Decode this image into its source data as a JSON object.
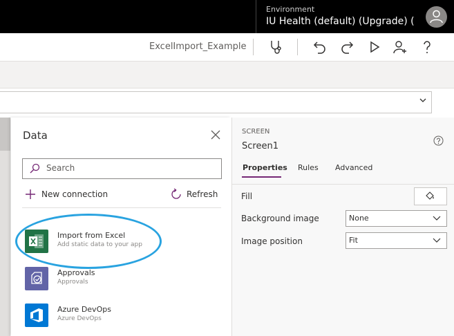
{
  "header": {
    "environment_label": "Environment",
    "environment_value": "IU Health (default) (Upgrade) (o..."
  },
  "commandbar": {
    "app_name": "ExcelImport_Example"
  },
  "data_panel": {
    "title": "Data",
    "search_placeholder": "Search",
    "new_connection_label": "New connection",
    "refresh_label": "Refresh",
    "items": [
      {
        "title": "Import from Excel",
        "subtitle": "Add static data to your app",
        "icon": "excel-icon",
        "color": "#217346"
      },
      {
        "title": "Approvals",
        "subtitle": "Approvals",
        "icon": "approvals-icon",
        "color": "#6264a7"
      },
      {
        "title": "Azure DevOps",
        "subtitle": "Azure DevOps",
        "icon": "azure-devops-icon",
        "color": "#0078d4"
      }
    ]
  },
  "properties": {
    "section_label": "SCREEN",
    "screen_name": "Screen1",
    "tabs": [
      "Properties",
      "Rules",
      "Advanced"
    ],
    "fill_label": "Fill",
    "background_image_label": "Background image",
    "background_image_value": "None",
    "image_position_label": "Image position",
    "image_position_value": "Fit"
  },
  "colors": {
    "accent": "#742774",
    "highlight": "#29a3e0"
  }
}
